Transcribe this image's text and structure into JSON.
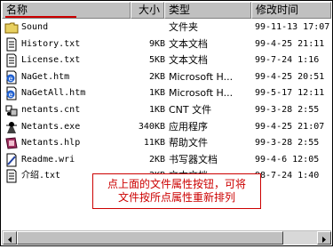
{
  "columns": {
    "name": "名称",
    "size": "大小",
    "type": "类型",
    "time": "修改时间"
  },
  "files": [
    {
      "icon": "folder-icon",
      "name": "Sound",
      "size": "",
      "type": "文件夹",
      "time": "99-11-13 17:07"
    },
    {
      "icon": "text-file-icon",
      "name": "History.txt",
      "size": "9KB",
      "type": "文本文档",
      "time": "99-4-25 21:11"
    },
    {
      "icon": "text-file-icon",
      "name": "License.txt",
      "size": "5KB",
      "type": "文本文档",
      "time": "99-7-24 1:16"
    },
    {
      "icon": "html-file-icon",
      "name": "NaGet.htm",
      "size": "2KB",
      "type": "Microsoft H...",
      "time": "99-4-25 20:51"
    },
    {
      "icon": "html-file-icon",
      "name": "NaGetAll.htm",
      "size": "1KB",
      "type": "Microsoft H...",
      "time": "99-5-17 12:11"
    },
    {
      "icon": "cnt-file-icon",
      "name": "netants.cnt",
      "size": "1KB",
      "type": "CNT 文件",
      "time": "99-3-28 2:55"
    },
    {
      "icon": "app-exe-icon",
      "name": "Netants.exe",
      "size": "340KB",
      "type": "应用程序",
      "time": "99-4-25 21:07"
    },
    {
      "icon": "help-file-icon",
      "name": "Netants.hlp",
      "size": "11KB",
      "type": "帮助文件",
      "time": "99-3-28 2:55"
    },
    {
      "icon": "wri-file-icon",
      "name": "Readme.wri",
      "size": "2KB",
      "type": "书写器文档",
      "time": "99-4-6 12:05"
    },
    {
      "icon": "text-file-icon",
      "name": "介绍.txt",
      "size": "2KB",
      "type": "文本文档",
      "time": "98-7-24 1:40"
    }
  ],
  "callout": {
    "line1": "点上面的文件属性按钮，可将",
    "line2": "文件按所点属性重新排列"
  }
}
